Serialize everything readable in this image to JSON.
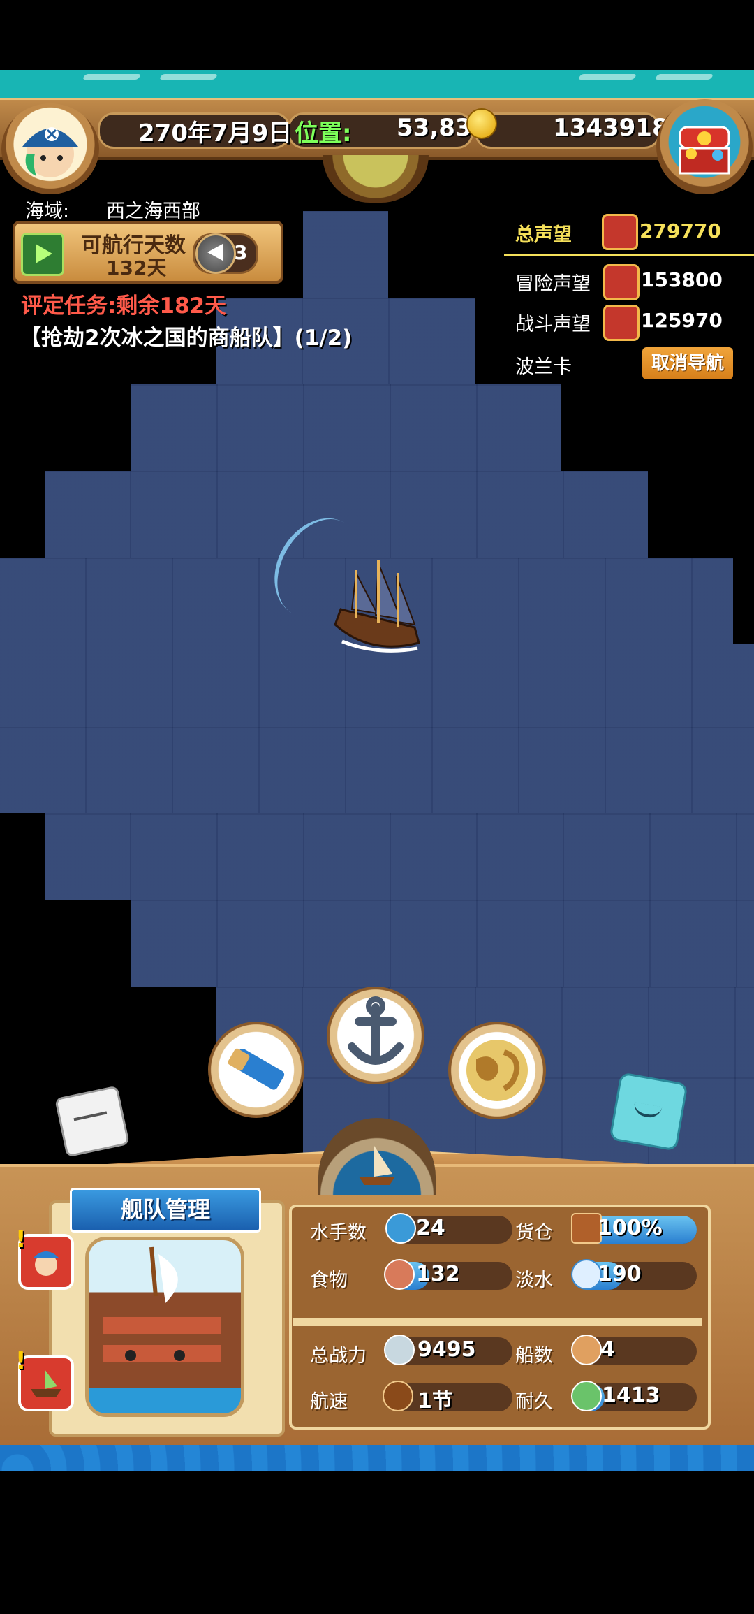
{
  "header": {
    "date": "270年7月9日",
    "position_label": "位置:",
    "position_value": "53,83",
    "gold": "1343918"
  },
  "sea_info": {
    "area_label": "海域:",
    "area_name": "西之海西部"
  },
  "sailing": {
    "label": "可航行天数",
    "days": "132天",
    "compass_count": "3"
  },
  "mission": {
    "deadline": "评定任务:剩余182天",
    "task": "【抢劫2次冰之国的商船队】(1/2)"
  },
  "reputation": {
    "total_label": "总声望",
    "total_value": "279770",
    "adventure_label": "冒险声望",
    "adventure_value": "153800",
    "combat_label": "战斗声望",
    "combat_value": "125970",
    "destination": "波兰卡",
    "cancel_nav": "取消导航"
  },
  "fleet": {
    "title": "舰队管理",
    "stats": {
      "sailors_label": "水手数",
      "sailors_value": "24",
      "cargo_label": "货仓",
      "cargo_value": "100%",
      "cargo_fill": 1.0,
      "food_label": "食物",
      "food_value": "132",
      "food_fill": 0.3,
      "water_label": "淡水",
      "water_value": "190",
      "water_fill": 0.4,
      "power_label": "总战力",
      "power_value": "9495",
      "ships_label": "船数",
      "ships_value": "4",
      "speed_label": "航速",
      "speed_value": "1节",
      "durability_label": "耐久",
      "durability_value": "1413",
      "durability_fill": 0.25
    }
  },
  "colors": {
    "teal": "#18b5b4",
    "sea": "#2e4272",
    "gold_text": "#f5e05a",
    "mission_red": "#ff5a4a",
    "position_green": "#7dff5a"
  }
}
